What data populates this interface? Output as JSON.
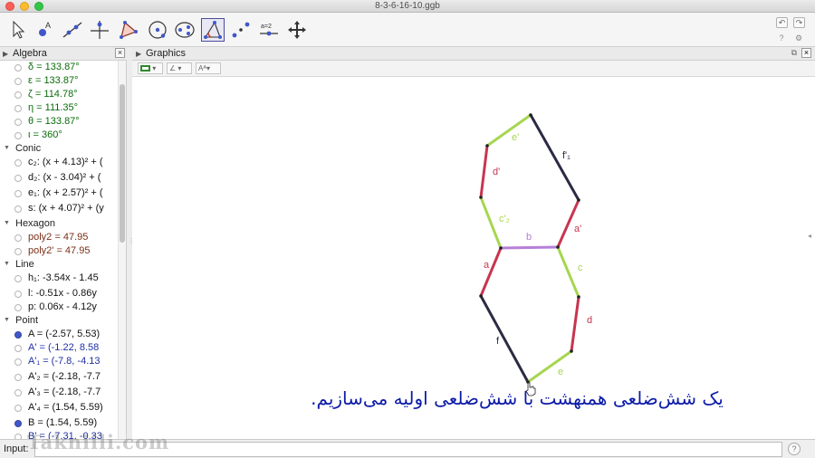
{
  "window": {
    "title": "8-3-6-16-10.ggb"
  },
  "algebra": {
    "title": "Algebra",
    "rows": [
      {
        "text": "δ = 133.87°",
        "color": "#0a6b0a",
        "dot": "empty"
      },
      {
        "text": "ε = 133.87°",
        "color": "#0a6b0a",
        "dot": "empty"
      },
      {
        "text": "ζ = 114.78°",
        "color": "#0a6b0a",
        "dot": "empty"
      },
      {
        "text": "η = 111.35°",
        "color": "#0a6b0a",
        "dot": "empty"
      },
      {
        "text": "θ = 133.87°",
        "color": "#0a6b0a",
        "dot": "empty"
      },
      {
        "text": "ι = 360°",
        "color": "#0a6b0a",
        "dot": "empty"
      },
      {
        "category": "Conic"
      },
      {
        "text": "c₂: (x + 4.13)² + (",
        "color": "#111111",
        "dot": "empty"
      },
      {
        "text": "d₂: (x - 3.04)² + (",
        "color": "#111111",
        "dot": "empty"
      },
      {
        "text": "e₁: (x + 2.57)² + (",
        "color": "#111111",
        "dot": "empty"
      },
      {
        "text": "s: (x + 4.07)² + (y",
        "color": "#111111",
        "dot": "empty"
      },
      {
        "category": "Hexagon"
      },
      {
        "text": "poly2 = 47.95",
        "color": "#7a2f18",
        "dot": "empty"
      },
      {
        "text": "poly2' = 47.95",
        "color": "#7a2f18",
        "dot": "empty"
      },
      {
        "category": "Line"
      },
      {
        "text": "h₁: -3.54x - 1.45",
        "color": "#111111",
        "dot": "empty"
      },
      {
        "text": "l: -0.51x - 0.86y",
        "color": "#111111",
        "dot": "empty"
      },
      {
        "text": "p: 0.06x - 4.12y",
        "color": "#111111",
        "dot": "empty"
      },
      {
        "category": "Point"
      },
      {
        "text": "A = (-2.57, 5.53)",
        "color": "#111111",
        "dot": "filled"
      },
      {
        "text": "A' = (-1.22, 8.58",
        "color": "#1d2fa3",
        "dot": "empty"
      },
      {
        "text": "A'₁ = (-7.8, -4.13",
        "color": "#1d2fa3",
        "dot": "empty"
      },
      {
        "text": "A'₂ = (-2.18, -7.7",
        "color": "#111111",
        "dot": "empty"
      },
      {
        "text": "A'₃ = (-2.18, -7.7",
        "color": "#111111",
        "dot": "empty"
      },
      {
        "text": "A'₄ = (1.54, 5.59)",
        "color": "#111111",
        "dot": "empty"
      },
      {
        "text": "B = (1.54, 5.59)",
        "color": "#111111",
        "dot": "filled"
      },
      {
        "text": "B' = (-7.31, -0.33",
        "color": "#1d2fa3",
        "dot": "empty"
      }
    ]
  },
  "graphics": {
    "title": "Graphics",
    "segments": [
      {
        "name": "e'",
        "color": "#a6d650",
        "from": "T",
        "to": "UL"
      },
      {
        "name": "f'₁",
        "color": "#2b2b44",
        "from": "T",
        "to": "UR"
      },
      {
        "name": "d'",
        "color": "#c83550",
        "from": "UL",
        "to": "ML"
      },
      {
        "name": "c'₂",
        "color": "#a6d650",
        "from": "ML",
        "to": "CL"
      },
      {
        "name": "a'",
        "color": "#c83550",
        "from": "UR",
        "to": "CR"
      },
      {
        "name": "b",
        "color": "#b77fd8",
        "from": "CL",
        "to": "CR"
      },
      {
        "name": "a",
        "color": "#c83550",
        "from": "CL",
        "to": "LL"
      },
      {
        "name": "c",
        "color": "#a6d650",
        "from": "CR",
        "to": "LR"
      },
      {
        "name": "f",
        "color": "#2b2b44",
        "from": "LL",
        "to": "BT"
      },
      {
        "name": "d",
        "color": "#c83550",
        "from": "LR",
        "to": "BR"
      },
      {
        "name": "e",
        "color": "#a6d650",
        "from": "BR",
        "to": "BT"
      }
    ]
  },
  "subtitle": "یک شش‌ضلعی همنهشت با شش‌ضلعی اولیه می‌سازیم.",
  "input": {
    "label": "Input:"
  },
  "watermark": "Takniili.com"
}
